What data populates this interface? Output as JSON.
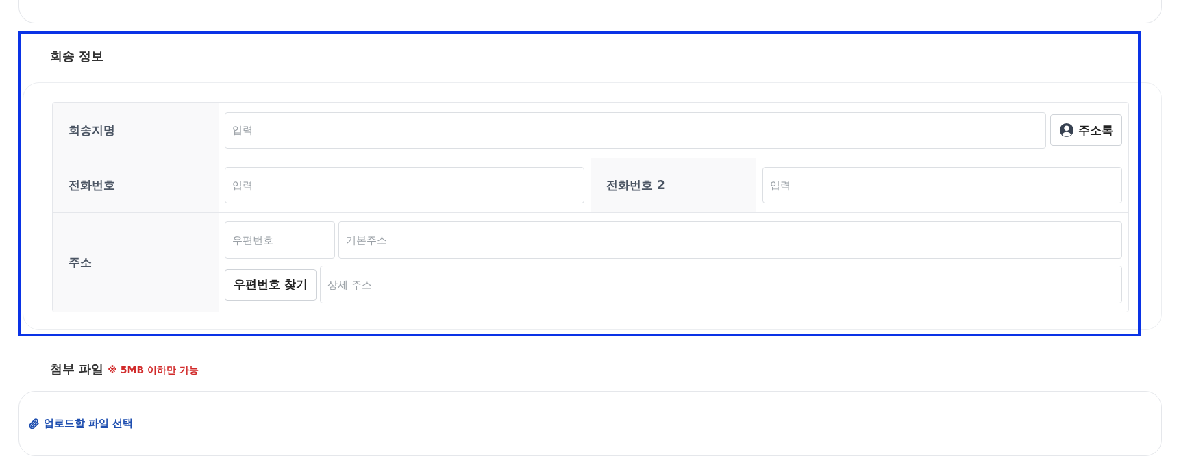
{
  "return_info": {
    "title": "회송 정보",
    "highlighted": true,
    "rows": [
      {
        "kind": "name",
        "label": "회송지명",
        "placeholder": "입력",
        "button": "주소록"
      },
      {
        "kind": "phones",
        "label": "전화번호",
        "placeholder": "입력",
        "label_2": "전화번호 2",
        "placeholder_2": "입력"
      },
      {
        "kind": "address",
        "label": "주소",
        "zip_placeholder": "우편번호",
        "base_placeholder": "기본주소",
        "button": "우편번호 찾기",
        "detail_placeholder": "상세 주소"
      }
    ]
  },
  "attachments": {
    "title": "첨부 파일",
    "note": "※ 5MB 이하만 가능",
    "link": "업로드할 파일 선택"
  }
}
